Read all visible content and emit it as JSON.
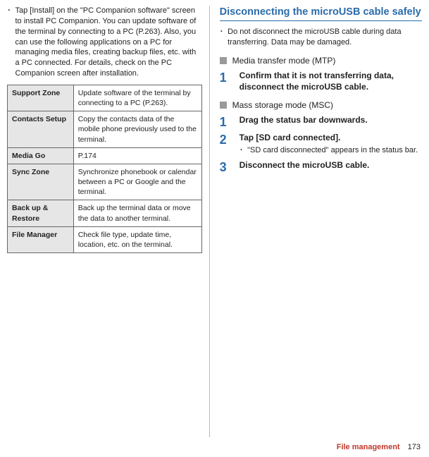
{
  "left": {
    "bullet_text": "Tap [Install] on the \"PC Companion software\" screen to install PC Companion. You can update software of the terminal by connecting to a PC (P.263). Also, you can use the following applications on a PC for managing media files, creating backup files, etc. with a PC connected. For details, check on the PC Companion screen after installation.",
    "table": [
      {
        "label": "Support Zone",
        "desc": "Update software of the terminal by connecting to a PC (P.263)."
      },
      {
        "label": "Contacts Setup",
        "desc": "Copy the contacts data of the mobile phone previously used to the terminal."
      },
      {
        "label": "Media Go",
        "desc": "P.174"
      },
      {
        "label": "Sync Zone",
        "desc": "Synchronize phonebook or calendar between a PC or Google and the terminal."
      },
      {
        "label": "Back up & Restore",
        "desc": "Back up the terminal data or move the data to another terminal."
      },
      {
        "label": "File Manager",
        "desc": "Check file type, update time, location, etc. on the terminal."
      }
    ]
  },
  "right": {
    "heading": "Disconnecting the microUSB cable safely",
    "warning": "Do not disconnect the microUSB cable during data transferring. Data may be damaged.",
    "mode_mtp": "Media transfer mode (MTP)",
    "mtp_steps": [
      {
        "title": "Confirm that it is not transferring data, disconnect the microUSB cable."
      }
    ],
    "mode_msc": "Mass storage mode (MSC)",
    "msc_steps": [
      {
        "title": "Drag the status bar downwards."
      },
      {
        "title": "Tap [SD card connected].",
        "sub": "\"SD card disconnected\" appears in the status bar."
      },
      {
        "title": "Disconnect the microUSB cable."
      }
    ]
  },
  "footer": {
    "section": "File management",
    "page": "173"
  }
}
